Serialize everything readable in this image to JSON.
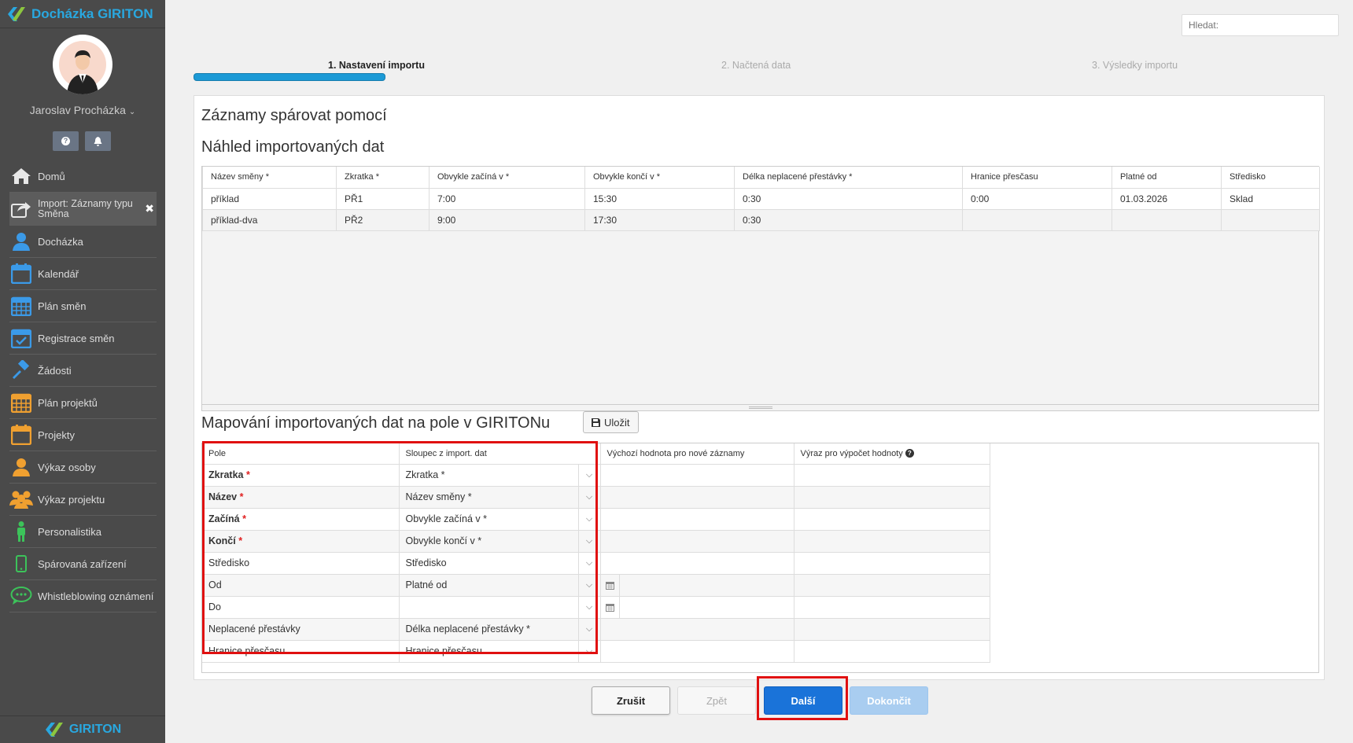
{
  "app": {
    "title": "Docházka GIRITON",
    "footer_brand": "GIRITON"
  },
  "user": {
    "name": "Jaroslav Procházka"
  },
  "sidebar": {
    "items": [
      {
        "label": "Domů",
        "icon": "home-icon"
      },
      {
        "label": "Import: Záznamy typu Směna",
        "icon": "import-icon",
        "active": true
      },
      {
        "label": "Docházka",
        "icon": "person-icon"
      },
      {
        "label": "Kalendář",
        "icon": "calendar-icon"
      },
      {
        "label": "Plán směn",
        "icon": "calendar-grid-icon"
      },
      {
        "label": "Registrace směn",
        "icon": "calendar-check-icon"
      },
      {
        "label": "Žádosti",
        "icon": "gavel-icon"
      },
      {
        "label": "Plán projektů",
        "icon": "calendar-grid-icon"
      },
      {
        "label": "Projekty",
        "icon": "calendar-icon"
      },
      {
        "label": "Výkaz osoby",
        "icon": "person-icon"
      },
      {
        "label": "Výkaz projektu",
        "icon": "group-icon"
      },
      {
        "label": "Personalistika",
        "icon": "standing-person-icon"
      },
      {
        "label": "Spárovaná zařízení",
        "icon": "mobile-icon"
      },
      {
        "label": "Whistleblowing oznámení",
        "icon": "chat-icon"
      }
    ]
  },
  "search": {
    "placeholder": "Hledat:"
  },
  "steps": [
    "1. Nastavení importu",
    "2. Načtená data",
    "3. Výsledky importu"
  ],
  "headings": {
    "match": "Záznamy spárovat pomocí",
    "preview": "Náhled importovaných dat",
    "mapping": "Mapování importovaných dat na pole v GIRITONu"
  },
  "save_label": "Uložit",
  "preview": {
    "columns": [
      "Název směny *",
      "Zkratka *",
      "Obvykle začíná v *",
      "Obvykle končí v *",
      "Délka neplacené přestávky *",
      "Hranice přesčasu",
      "Platné od",
      "Středisko"
    ],
    "rows": [
      [
        "příklad",
        "PŘ1",
        "7:00",
        "15:30",
        "0:30",
        "0:00",
        "01.03.2026",
        "Sklad"
      ],
      [
        "příklad-dva",
        "PŘ2",
        "9:00",
        "17:30",
        "0:30",
        "",
        "",
        ""
      ]
    ]
  },
  "mapping": {
    "columns": [
      "Pole",
      "Sloupec z import. dat",
      "Výchozí hodnota pro nové záznamy",
      "Výraz pro výpočet hodnoty"
    ],
    "rows": [
      {
        "field": "Zkratka",
        "required": true,
        "source": "Zkratka *",
        "date": false
      },
      {
        "field": "Název",
        "required": true,
        "source": "Název směny *",
        "date": false
      },
      {
        "field": "Začíná",
        "required": true,
        "source": "Obvykle začíná v *",
        "date": false
      },
      {
        "field": "Končí",
        "required": true,
        "source": "Obvykle končí v *",
        "date": false
      },
      {
        "field": "Středisko",
        "required": false,
        "source": "Středisko",
        "date": false
      },
      {
        "field": "Od",
        "required": false,
        "source": "Platné od",
        "date": true
      },
      {
        "field": "Do",
        "required": false,
        "source": "",
        "date": true
      },
      {
        "field": "Neplacené přestávky",
        "required": false,
        "source": "Délka neplacené přestávky *",
        "date": false
      },
      {
        "field": "Hranice přesčasu",
        "required": false,
        "source": "Hranice přesčasu",
        "date": false
      }
    ]
  },
  "buttons": {
    "cancel": "Zrušit",
    "back": "Zpět",
    "next": "Další",
    "finish": "Dokončit"
  }
}
